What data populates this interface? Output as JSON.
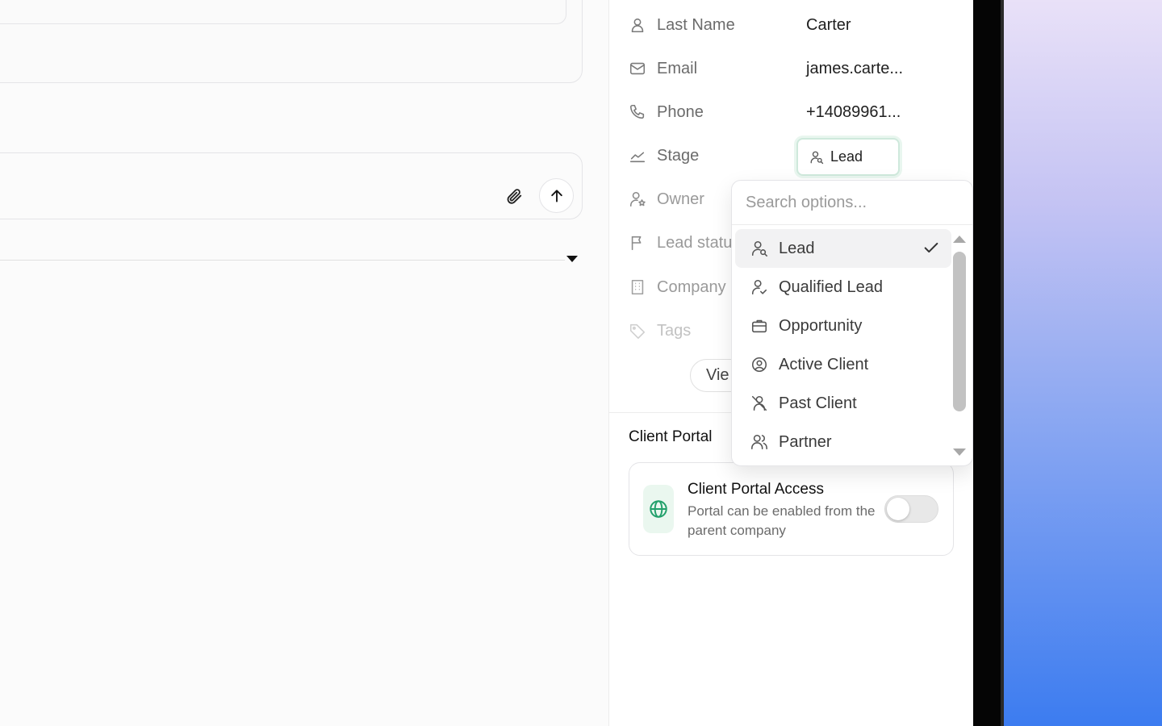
{
  "fields": [
    {
      "label": "Last Name",
      "value": "Carter",
      "icon": "person-icon"
    },
    {
      "label": "Email",
      "value": "james.carte...",
      "icon": "mail-icon"
    },
    {
      "label": "Phone",
      "value": "+14089961...",
      "icon": "phone-icon"
    },
    {
      "label": "Stage",
      "value": "Lead",
      "icon": "chart-line-icon"
    },
    {
      "label": "Owner",
      "value": "",
      "icon": "person-star-icon"
    },
    {
      "label": "Lead status",
      "value": "",
      "icon": "flag-icon"
    },
    {
      "label": "Company",
      "value": "",
      "icon": "building-icon"
    },
    {
      "label": "Tags",
      "value": "",
      "icon": "tag-icon"
    }
  ],
  "view_button": "Vie",
  "dropdown": {
    "search_placeholder": "Search options...",
    "options": [
      {
        "label": "Lead",
        "icon": "person-search-icon",
        "selected": true
      },
      {
        "label": "Qualified Lead",
        "icon": "person-check-icon",
        "selected": false
      },
      {
        "label": "Opportunity",
        "icon": "briefcase-icon",
        "selected": false
      },
      {
        "label": "Active Client",
        "icon": "user-circle-icon",
        "selected": false
      },
      {
        "label": "Past Client",
        "icon": "person-off-icon",
        "selected": false
      },
      {
        "label": "Partner",
        "icon": "users-icon",
        "selected": false
      }
    ]
  },
  "client_portal": {
    "heading": "Client Portal",
    "title": "Client Portal Access",
    "description": "Portal can be enabled from the parent company",
    "enabled": false
  },
  "colors": {
    "accent_green": "#22a06b",
    "portal_icon_bg": "#eaf7ef"
  }
}
